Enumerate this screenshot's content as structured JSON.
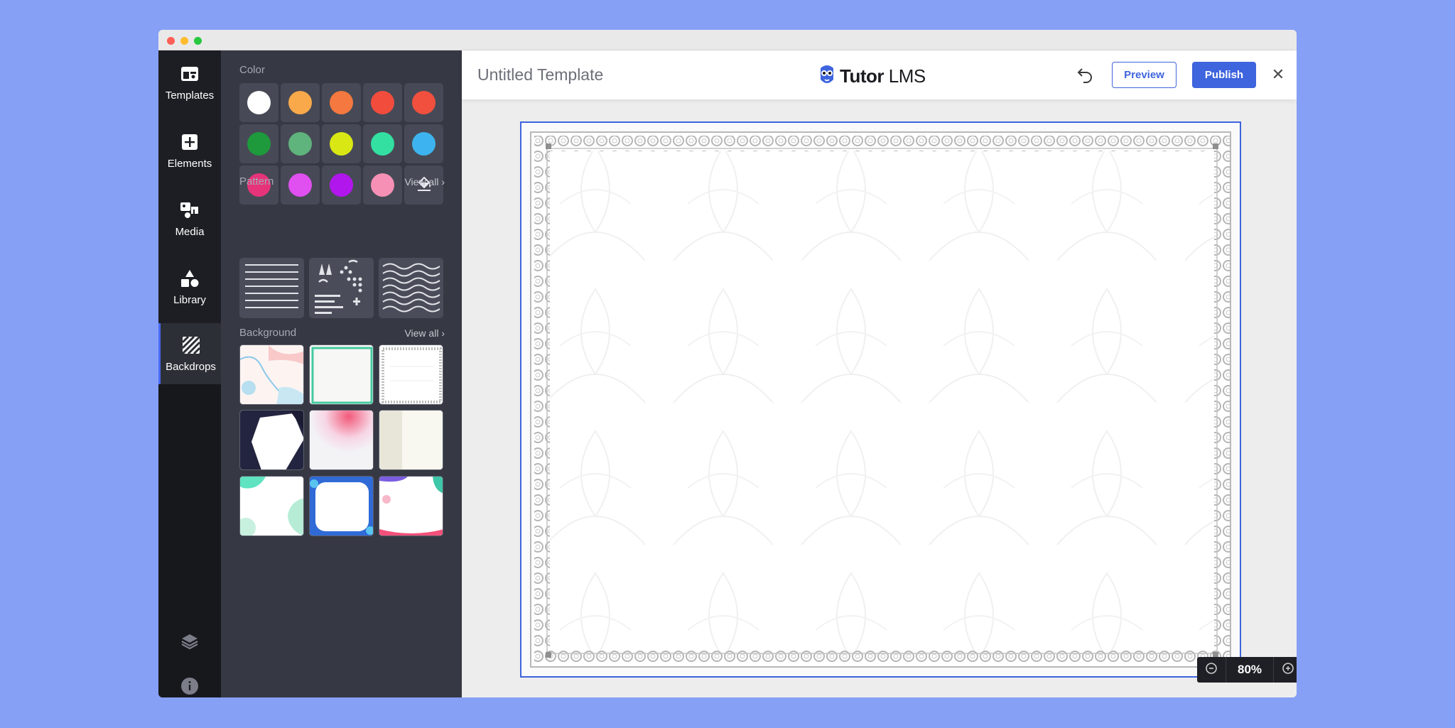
{
  "nav": {
    "items": [
      {
        "label": "Templates",
        "icon": "templates-icon"
      },
      {
        "label": "Elements",
        "icon": "plus-square-icon"
      },
      {
        "label": "Media",
        "icon": "media-icon"
      },
      {
        "label": "Library",
        "icon": "shapes-icon"
      },
      {
        "label": "Backdrops",
        "icon": "stripes-icon",
        "active": true
      }
    ],
    "footer_icons": [
      "layers-icon",
      "info-icon"
    ]
  },
  "panel": {
    "color_label": "Color",
    "colors": [
      "#ffffff",
      "#f9a94a",
      "#f4783f",
      "#f24c3d",
      "#f1503e",
      "#1e9a3c",
      "#5fb37c",
      "#d9e815",
      "#33e0a1",
      "#3db4ef",
      "#e6337a",
      "#e04ff0",
      "#b116ec",
      "#f790b5"
    ],
    "fill_tool_icon": "paint-bucket-icon",
    "pattern_label": "Pattern",
    "pattern_view_all": "View all",
    "background_label": "Background",
    "background_view_all": "View all"
  },
  "header": {
    "title": "Untitled Template",
    "logo_bold": "Tutor",
    "logo_light": "LMS",
    "preview": "Preview",
    "publish": "Publish",
    "close": "✕"
  },
  "zoom": {
    "value": "80%"
  },
  "colors": {
    "accent": "#3e64de",
    "rail_bg": "#1d1e23",
    "panel_bg": "#363843"
  }
}
